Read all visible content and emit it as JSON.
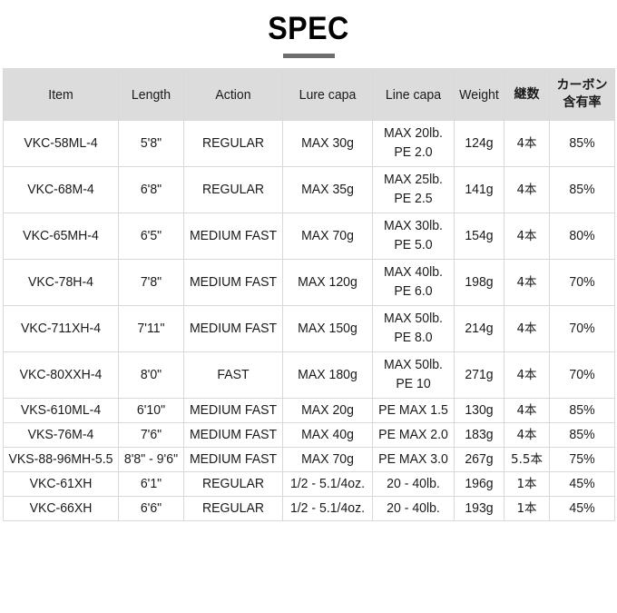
{
  "page": {
    "title": "SPEC"
  },
  "table": {
    "headers": [
      {
        "key": "item",
        "label": "Item",
        "jp": false
      },
      {
        "key": "length",
        "label": "Length",
        "jp": false
      },
      {
        "key": "action",
        "label": "Action",
        "jp": false
      },
      {
        "key": "lure",
        "label": "Lure capa",
        "jp": false
      },
      {
        "key": "line",
        "label": "Line capa",
        "jp": false
      },
      {
        "key": "weight",
        "label": "Weight",
        "jp": false
      },
      {
        "key": "pieces",
        "label": "継数",
        "jp": true
      },
      {
        "key": "carbon",
        "label": "カーボン含有率",
        "jp": true,
        "line1": "カーボン",
        "line2": "含有率"
      }
    ],
    "rows": [
      {
        "item": "VKC-58ML-4",
        "length": "5'8\"",
        "action": "REGULAR",
        "lure": "MAX 30g",
        "line_1": "MAX 20lb.",
        "line_2": "PE 2.0",
        "weight": "124g",
        "pieces": "4本",
        "carbon": "85%",
        "size": "tall"
      },
      {
        "item": "VKC-68M-4",
        "length": "6'8\"",
        "action": "REGULAR",
        "lure": "MAX 35g",
        "line_1": "MAX 25lb.",
        "line_2": "PE 2.5",
        "weight": "141g",
        "pieces": "4本",
        "carbon": "85%",
        "size": "tall"
      },
      {
        "item": "VKC-65MH-4",
        "length": "6'5\"",
        "action": "MEDIUM FAST",
        "lure": "MAX 70g",
        "line_1": "MAX 30lb.",
        "line_2": "PE 5.0",
        "weight": "154g",
        "pieces": "4本",
        "carbon": "80%",
        "size": "tall"
      },
      {
        "item": "VKC-78H-4",
        "length": "7'8\"",
        "action": "MEDIUM FAST",
        "lure": "MAX 120g",
        "line_1": "MAX 40lb.",
        "line_2": "PE 6.0",
        "weight": "198g",
        "pieces": "4本",
        "carbon": "70%",
        "size": "tall"
      },
      {
        "item": "VKC-711XH-4",
        "length": "7'11\"",
        "action": "MEDIUM FAST",
        "lure": "MAX 150g",
        "line_1": "MAX 50lb.",
        "line_2": "PE 8.0",
        "weight": "214g",
        "pieces": "4本",
        "carbon": "70%",
        "size": "tall"
      },
      {
        "item": "VKC-80XXH-4",
        "length": "8'0\"",
        "action": "FAST",
        "lure": "MAX 180g",
        "line_1": "MAX 50lb.",
        "line_2": "PE 10",
        "weight": "271g",
        "pieces": "4本",
        "carbon": "70%",
        "size": "tall"
      },
      {
        "item": "VKS-610ML-4",
        "length": "6'10\"",
        "action": "MEDIUM FAST",
        "lure": "MAX 20g",
        "line_1": "PE MAX 1.5",
        "line_2": "",
        "weight": "130g",
        "pieces": "4本",
        "carbon": "85%",
        "size": "short"
      },
      {
        "item": "VKS-76M-4",
        "length": "7'6\"",
        "action": "MEDIUM FAST",
        "lure": "MAX 40g",
        "line_1": "PE MAX 2.0",
        "line_2": "",
        "weight": "183g",
        "pieces": "4本",
        "carbon": "85%",
        "size": "short"
      },
      {
        "item": "VKS-88-96MH-5.5",
        "length": "8'8\" - 9'6\"",
        "action": "MEDIUM FAST",
        "lure": "MAX 70g",
        "line_1": "PE MAX 3.0",
        "line_2": "",
        "weight": "267g",
        "pieces": "5.5本",
        "carbon": "75%",
        "size": "short"
      },
      {
        "item": "VKC-61XH",
        "length": "6'1\"",
        "action": "REGULAR",
        "lure": "1/2 - 5.1/4oz.",
        "line_1": "20 - 40lb.",
        "line_2": "",
        "weight": "196g",
        "pieces": "1本",
        "carbon": "45%",
        "size": "short"
      },
      {
        "item": "VKC-66XH",
        "length": "6'6\"",
        "action": "REGULAR",
        "lure": "1/2 - 5.1/4oz.",
        "line_1": "20 - 40lb.",
        "line_2": "",
        "weight": "193g",
        "pieces": "1本",
        "carbon": "45%",
        "size": "short"
      }
    ]
  },
  "colors": {
    "header_bg": "#dcdcdc",
    "rule": "#6e6e6e",
    "border": "#d9d9d9",
    "text": "#1a1a1a"
  }
}
